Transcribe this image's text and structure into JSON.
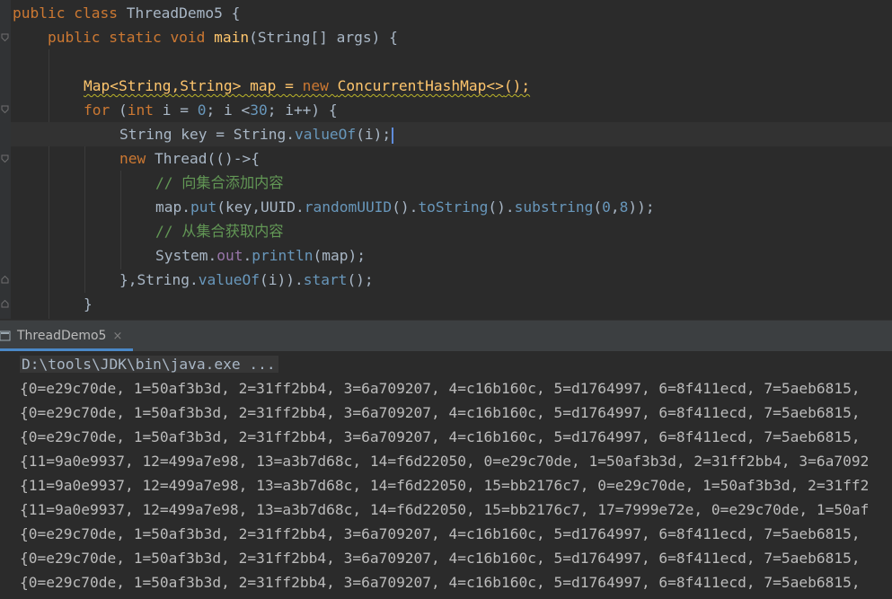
{
  "editor": {
    "code": {
      "l1": {
        "kw": "public class ",
        "cls": "ThreadDemo5",
        "rest": " {"
      },
      "l2": {
        "kw": "public static void ",
        "mth": "main",
        "p1": "(",
        "t": "String",
        "p2": "[] ",
        "a": "args",
        "p3": ") {"
      },
      "l4": {
        "t1": "Map<String,String>",
        "sp": " map = ",
        "kw": "new ",
        "t2": "ConcurrentHashMap<>",
        "end": "();"
      },
      "l5": {
        "kw": "for ",
        "p1": "(",
        "kw2": "int",
        "p2": " i = ",
        "n0": "0",
        "p3": "; i <",
        "n30": "30",
        "p4": "; i++) {"
      },
      "l6": {
        "t": "String",
        "p1": " key = ",
        "t2": "String",
        "dot": ".",
        "m": "valueOf",
        "p2": "(i);"
      },
      "l7": {
        "kw": "new ",
        "t": "Thread",
        "p": "(()->{"
      },
      "l8": {
        "cmt": "// 向集合添加内容"
      },
      "l9": {
        "a": "map",
        "d1": ".",
        "m1": "put",
        "p1": "(key,",
        "c": "UUID",
        "d2": ".",
        "m2": "randomUUID",
        "p2": "().",
        "m3": "toString",
        "p3": "().",
        "m4": "substring",
        "p4": "(",
        "n0": "0",
        "cm": ",",
        "n8": "8",
        "p5": "));"
      },
      "l10": {
        "cmt": "// 从集合获取内容"
      },
      "l11": {
        "c": "System",
        "d1": ".",
        "f": "out",
        "d2": ".",
        "m": "println",
        "p": "(map);"
      },
      "l12": {
        "p1": "},",
        "t": "String",
        "d": ".",
        "m": "valueOf",
        "p2": "(i)).",
        "m2": "start",
        "p3": "();"
      },
      "l13": {
        "p": "}"
      }
    }
  },
  "run_tab": {
    "label": "ThreadDemo5",
    "close": "×"
  },
  "console": {
    "command": "D:\\tools\\JDK\\bin\\java.exe ...",
    "lines": [
      "{0=e29c70de, 1=50af3b3d, 2=31ff2bb4, 3=6a709207, 4=c16b160c, 5=d1764997, 6=8f411ecd, 7=5aeb6815,",
      "{0=e29c70de, 1=50af3b3d, 2=31ff2bb4, 3=6a709207, 4=c16b160c, 5=d1764997, 6=8f411ecd, 7=5aeb6815,",
      "{0=e29c70de, 1=50af3b3d, 2=31ff2bb4, 3=6a709207, 4=c16b160c, 5=d1764997, 6=8f411ecd, 7=5aeb6815,",
      "{11=9a0e9937, 12=499a7e98, 13=a3b7d68c, 14=f6d22050, 0=e29c70de, 1=50af3b3d, 2=31ff2bb4, 3=6a7092",
      "{11=9a0e9937, 12=499a7e98, 13=a3b7d68c, 14=f6d22050, 15=bb2176c7, 0=e29c70de, 1=50af3b3d, 2=31ff2",
      "{11=9a0e9937, 12=499a7e98, 13=a3b7d68c, 14=f6d22050, 15=bb2176c7, 17=7999e72e, 0=e29c70de, 1=50af",
      "{0=e29c70de, 1=50af3b3d, 2=31ff2bb4, 3=6a709207, 4=c16b160c, 5=d1764997, 6=8f411ecd, 7=5aeb6815,",
      "{0=e29c70de, 1=50af3b3d, 2=31ff2bb4, 3=6a709207, 4=c16b160c, 5=d1764997, 6=8f411ecd, 7=5aeb6815,",
      "{0=e29c70de, 1=50af3b3d, 2=31ff2bb4, 3=6a709207, 4=c16b160c, 5=d1764997, 6=8f411ecd, 7=5aeb6815,"
    ]
  },
  "colors": {
    "keyword": "#cc7832",
    "method": "#ffc66d",
    "number": "#6897bb",
    "comment": "#629755",
    "field": "#9876aa",
    "text": "#a9b7c6",
    "tab_accent": "#4a88c7"
  },
  "icons": {
    "tab": "run-console-icon",
    "gutter": "fold-icon"
  }
}
